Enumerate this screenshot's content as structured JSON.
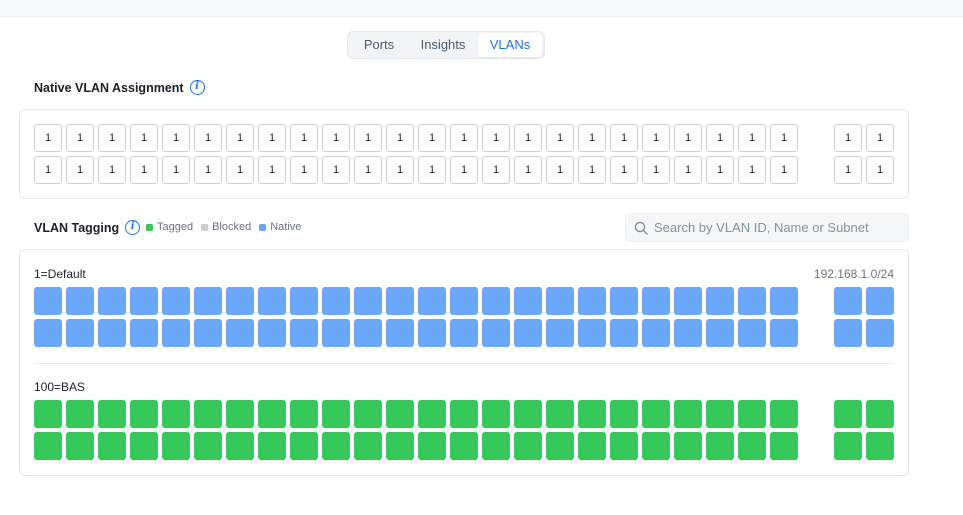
{
  "tabs": [
    {
      "label": "Ports"
    },
    {
      "label": "Insights"
    },
    {
      "label": "VLANs"
    }
  ],
  "active_tab": "VLANs",
  "native_section": {
    "title": "Native VLAN Assignment",
    "info_icon": "info-icon",
    "ports_row1": [
      "1",
      "1",
      "1",
      "1",
      "1",
      "1",
      "1",
      "1",
      "1",
      "1",
      "1",
      "1",
      "1",
      "1",
      "1",
      "1",
      "1",
      "1",
      "1",
      "1",
      "1",
      "1",
      "1",
      "1",
      "1",
      "1"
    ],
    "ports_row2": [
      "1",
      "1",
      "1",
      "1",
      "1",
      "1",
      "1",
      "1",
      "1",
      "1",
      "1",
      "1",
      "1",
      "1",
      "1",
      "1",
      "1",
      "1",
      "1",
      "1",
      "1",
      "1",
      "1",
      "1",
      "1",
      "1"
    ]
  },
  "tagging_section": {
    "title": "VLAN Tagging",
    "info_icon": "info-icon",
    "legend": [
      {
        "label": "Tagged",
        "color": "#35c75a"
      },
      {
        "label": "Blocked",
        "color": "#c9cdd4"
      },
      {
        "label": "Native",
        "color": "#6aa7f8"
      }
    ],
    "search": {
      "placeholder": "Search by VLAN ID, Name or Subnet",
      "value": "",
      "icon": "search-icon"
    },
    "vlans": [
      {
        "name": "1=Default",
        "subnet": "192.168.1.0/24",
        "state": "Native",
        "color": "#6aa7f8"
      },
      {
        "name": "100=BAS",
        "subnet": "",
        "state": "Tagged",
        "color": "#35c75a"
      }
    ]
  },
  "ports_per_row": 26,
  "main_group_size": 24
}
